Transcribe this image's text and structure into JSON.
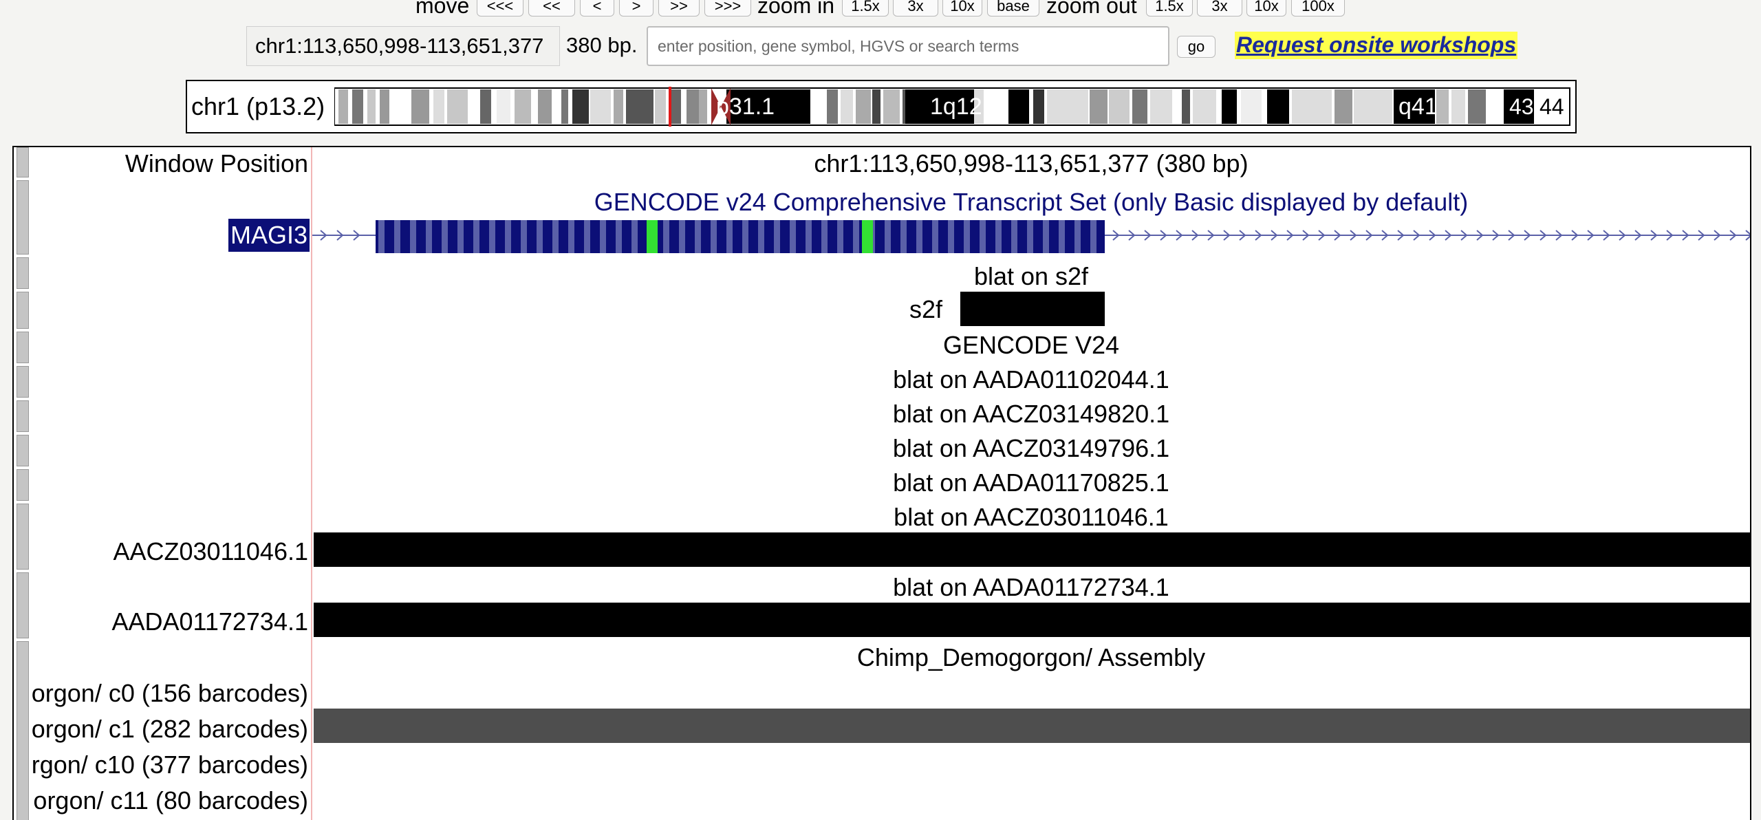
{
  "nav": {
    "move_label": "move",
    "move_buttons": [
      "<<<",
      "<<",
      "<",
      ">",
      ">>",
      ">>>"
    ],
    "zoom_in_label": "zoom in",
    "zoom_in_buttons": [
      "1.5x",
      "3x",
      "10x",
      "base"
    ],
    "zoom_out_label": "zoom out",
    "zoom_out_buttons": [
      "1.5x",
      "3x",
      "10x",
      "100x"
    ]
  },
  "position": {
    "value": "chr1:113,650,998-113,651,377",
    "size": "380 bp.",
    "search_placeholder": "enter position, gene symbol, HGVS or search terms",
    "go_label": "go",
    "workshop_link": "Request onsite workshops"
  },
  "ideogram": {
    "label": "chr1 (p13.2)",
    "bands": [
      "p31.1",
      "1q12",
      "q41",
      "43",
      "44"
    ]
  },
  "tracks": {
    "window_position_label": "Window Position",
    "window_position_value": "chr1:113,650,998-113,651,377 (380 bp)",
    "gencode_title": "GENCODE v24 Comprehensive Transcript Set (only Basic displayed by default)",
    "gene_name": "MAGI3",
    "blat_s2f_title": "blat on s2f",
    "s2f_label": "s2f",
    "gencode_v24_title": "GENCODE V24",
    "blat_titles": [
      "blat on AADA01102044.1",
      "blat on AACZ03149820.1",
      "blat on AACZ03149796.1",
      "blat on AADA01170825.1",
      "blat on AACZ03011046.1"
    ],
    "aacz_label": "AACZ03011046.1",
    "blat_aada_title": "blat on AADA01172734.1",
    "aada_label": "AADA01172734.1",
    "assembly_title": "Chimp_Demogorgon/ Assembly",
    "cluster_labels": [
      "orgon/ c0 (156 barcodes)",
      "orgon/ c1 (282 barcodes)",
      "rgon/ c10 (377 barcodes)",
      "orgon/ c11 (80 barcodes)"
    ]
  },
  "colors": {
    "gene_fill": "#0c0f77",
    "gene_stripe": "#5a60a8",
    "highlight": "#33e033",
    "workshop_bg": "#ffff4c",
    "workshop_text": "#1a2a9c"
  }
}
